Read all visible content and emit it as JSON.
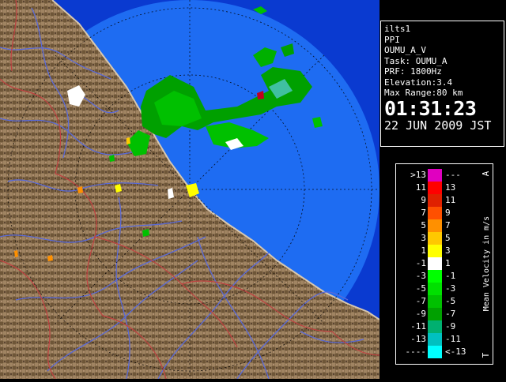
{
  "info": {
    "name": "ilts1",
    "product": "PPI",
    "site": "OUMU_A_V",
    "task": "Task: OUMU_A",
    "prf": "PRF: 1800Hz",
    "elevation": "Elevation:3.4",
    "max_range": "Max Range:80 km",
    "time": "01:31:23",
    "date": "22 JUN 2009 JST"
  },
  "legend": {
    "title": "Mean Velocity in m/s",
    "top_mark": "A",
    "bottom_mark": "T",
    "rows": [
      {
        "left": ">13",
        "right": "---",
        "color": "#e000c0"
      },
      {
        "left": "11",
        "right": "13",
        "color": "#ff0000"
      },
      {
        "left": "9",
        "right": "11",
        "color": "#e02000"
      },
      {
        "left": "7",
        "right": "9",
        "color": "#ff5000"
      },
      {
        "left": "5",
        "right": "7",
        "color": "#ff9000"
      },
      {
        "left": "3",
        "right": "5",
        "color": "#ffc800"
      },
      {
        "left": "1",
        "right": "3",
        "color": "#ffff00"
      },
      {
        "left": "-1",
        "right": "1",
        "color": "#ffffff"
      },
      {
        "left": "-3",
        "right": "-1",
        "color": "#00ff00"
      },
      {
        "left": "-5",
        "right": "-3",
        "color": "#00e000"
      },
      {
        "left": "-7",
        "right": "-5",
        "color": "#00c000"
      },
      {
        "left": "-9",
        "right": "-7",
        "color": "#00a000"
      },
      {
        "left": "-11",
        "right": "-9",
        "color": "#00b070"
      },
      {
        "left": "-13",
        "right": "-11",
        "color": "#00c0c0"
      },
      {
        "left": "----",
        "right": "<-13",
        "color": "#00ffff"
      }
    ]
  },
  "colors": {
    "sea": "#1e6cf2",
    "sea_outer": "#0a3ad0",
    "land": "#8a7050",
    "rivers": "#5a6ad8",
    "boundaries": "#c04040",
    "range_rings": "#000000"
  }
}
